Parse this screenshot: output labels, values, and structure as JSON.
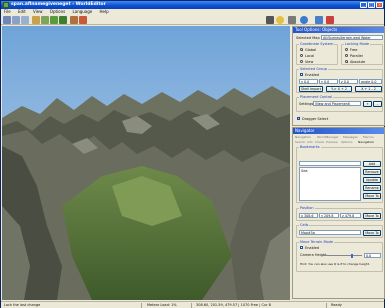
{
  "window": {
    "title": "span.aflnamegiveneget - WorldEditor",
    "minimize_glyph": "_",
    "maximize_glyph": "□",
    "close_glyph": "×"
  },
  "menu": [
    "File",
    "Edit",
    "View",
    "Options",
    "Language",
    "Help"
  ],
  "toolbar": {
    "icons": [
      "move-icon",
      "rotate-icon",
      "scale-icon",
      "select-icon",
      "terrain-icon",
      "grass-icon",
      "tree-icon",
      "brush-icon",
      "paint-icon",
      "camera-icon",
      "sun-icon",
      "settings-icon",
      "globe-icon",
      "help-icon",
      "exit-icon"
    ]
  },
  "tool_options": {
    "title": "Tool Options: Objects",
    "selected_map_label": "Selected Map",
    "selected_map_value": "All/Scenes/terrain.wed Water",
    "coordinate_system_label": "Coordinate System",
    "coordinate_options": [
      "Global",
      "Local",
      "View"
    ],
    "coordinate_selected": "Global",
    "locking_mode_label": "Locking Mode",
    "locking_options": [
      "Free",
      "Parallel",
      "Absolute"
    ],
    "locking_selected": "Absolute",
    "selected_group_label": "Selected Group",
    "enabled_label": "Enabled",
    "enabled_checked": false,
    "pos_fields": [
      "x  0.0",
      "y  0.0",
      "z  0.0",
      "angle  0.0"
    ],
    "buttons_row": [
      "Shell Import",
      "Y-> X + 2",
      "X + 1 - 2"
    ],
    "placement_label": "Placement Control",
    "settings_label": "Settings",
    "settings_value": "(New and Placement)",
    "sub_buttons": [
      "+",
      "-"
    ],
    "dragger_label": "Dragger Select",
    "dragger_checked": true
  },
  "navigator": {
    "title": "Navigator",
    "tabs_row1": [
      "Navigation",
      "WorldManager",
      "Messages",
      "Macros"
    ],
    "tabs_row2": [
      "Search",
      "Info",
      "Check",
      "Preview",
      "Options",
      "Navigation"
    ],
    "bookmarks_label": "Bookmarks",
    "bookmarks_value": "",
    "bookmarks_list": [
      "Sea"
    ],
    "bookmark_buttons": [
      "Add",
      "Remove",
      "Update",
      "Rename",
      "Move To"
    ],
    "position_label": "Position",
    "position_fields": [
      "x  308.6",
      "y  209.8",
      "z  479.8"
    ],
    "position_move_to": "Move To",
    "cells_label": "Cells",
    "cells_value": "Map#5a",
    "cells_move_to": "Move To",
    "follow_terrain_label": "Move Terrain Mode",
    "follow_enabled_label": "Enabled",
    "follow_enabled_checked": false,
    "camera_height_label": "Camera Height",
    "camera_height_value": "0.0",
    "camera_height_level": 0.75,
    "hint": "Hint: You can also use Q & E to change height."
  },
  "status": {
    "left": "Lock the last change",
    "middle": "Meteor Load: 1%",
    "coords": "308.60, 201.59, 479.57 | 1070 Free | Cur 8",
    "mode": "Ready"
  },
  "colors": {
    "titlebar": "#0b4fd0",
    "panel": "#ece9d8",
    "sky": "#9fc3e6"
  }
}
